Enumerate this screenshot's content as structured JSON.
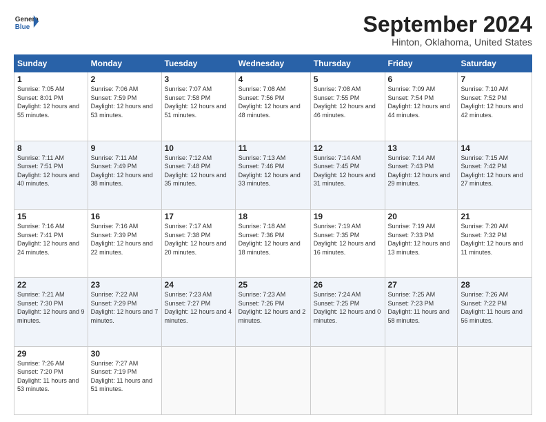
{
  "logo": {
    "line1": "General",
    "line2": "Blue"
  },
  "title": "September 2024",
  "subtitle": "Hinton, Oklahoma, United States",
  "weekdays": [
    "Sunday",
    "Monday",
    "Tuesday",
    "Wednesday",
    "Thursday",
    "Friday",
    "Saturday"
  ],
  "weeks": [
    [
      {
        "day": "1",
        "sunrise": "7:05 AM",
        "sunset": "8:01 PM",
        "daylight": "12 hours and 55 minutes."
      },
      {
        "day": "2",
        "sunrise": "7:06 AM",
        "sunset": "7:59 PM",
        "daylight": "12 hours and 53 minutes."
      },
      {
        "day": "3",
        "sunrise": "7:07 AM",
        "sunset": "7:58 PM",
        "daylight": "12 hours and 51 minutes."
      },
      {
        "day": "4",
        "sunrise": "7:08 AM",
        "sunset": "7:56 PM",
        "daylight": "12 hours and 48 minutes."
      },
      {
        "day": "5",
        "sunrise": "7:08 AM",
        "sunset": "7:55 PM",
        "daylight": "12 hours and 46 minutes."
      },
      {
        "day": "6",
        "sunrise": "7:09 AM",
        "sunset": "7:54 PM",
        "daylight": "12 hours and 44 minutes."
      },
      {
        "day": "7",
        "sunrise": "7:10 AM",
        "sunset": "7:52 PM",
        "daylight": "12 hours and 42 minutes."
      }
    ],
    [
      {
        "day": "8",
        "sunrise": "7:11 AM",
        "sunset": "7:51 PM",
        "daylight": "12 hours and 40 minutes."
      },
      {
        "day": "9",
        "sunrise": "7:11 AM",
        "sunset": "7:49 PM",
        "daylight": "12 hours and 38 minutes."
      },
      {
        "day": "10",
        "sunrise": "7:12 AM",
        "sunset": "7:48 PM",
        "daylight": "12 hours and 35 minutes."
      },
      {
        "day": "11",
        "sunrise": "7:13 AM",
        "sunset": "7:46 PM",
        "daylight": "12 hours and 33 minutes."
      },
      {
        "day": "12",
        "sunrise": "7:14 AM",
        "sunset": "7:45 PM",
        "daylight": "12 hours and 31 minutes."
      },
      {
        "day": "13",
        "sunrise": "7:14 AM",
        "sunset": "7:43 PM",
        "daylight": "12 hours and 29 minutes."
      },
      {
        "day": "14",
        "sunrise": "7:15 AM",
        "sunset": "7:42 PM",
        "daylight": "12 hours and 27 minutes."
      }
    ],
    [
      {
        "day": "15",
        "sunrise": "7:16 AM",
        "sunset": "7:41 PM",
        "daylight": "12 hours and 24 minutes."
      },
      {
        "day": "16",
        "sunrise": "7:16 AM",
        "sunset": "7:39 PM",
        "daylight": "12 hours and 22 minutes."
      },
      {
        "day": "17",
        "sunrise": "7:17 AM",
        "sunset": "7:38 PM",
        "daylight": "12 hours and 20 minutes."
      },
      {
        "day": "18",
        "sunrise": "7:18 AM",
        "sunset": "7:36 PM",
        "daylight": "12 hours and 18 minutes."
      },
      {
        "day": "19",
        "sunrise": "7:19 AM",
        "sunset": "7:35 PM",
        "daylight": "12 hours and 16 minutes."
      },
      {
        "day": "20",
        "sunrise": "7:19 AM",
        "sunset": "7:33 PM",
        "daylight": "12 hours and 13 minutes."
      },
      {
        "day": "21",
        "sunrise": "7:20 AM",
        "sunset": "7:32 PM",
        "daylight": "12 hours and 11 minutes."
      }
    ],
    [
      {
        "day": "22",
        "sunrise": "7:21 AM",
        "sunset": "7:30 PM",
        "daylight": "12 hours and 9 minutes."
      },
      {
        "day": "23",
        "sunrise": "7:22 AM",
        "sunset": "7:29 PM",
        "daylight": "12 hours and 7 minutes."
      },
      {
        "day": "24",
        "sunrise": "7:23 AM",
        "sunset": "7:27 PM",
        "daylight": "12 hours and 4 minutes."
      },
      {
        "day": "25",
        "sunrise": "7:23 AM",
        "sunset": "7:26 PM",
        "daylight": "12 hours and 2 minutes."
      },
      {
        "day": "26",
        "sunrise": "7:24 AM",
        "sunset": "7:25 PM",
        "daylight": "12 hours and 0 minutes."
      },
      {
        "day": "27",
        "sunrise": "7:25 AM",
        "sunset": "7:23 PM",
        "daylight": "11 hours and 58 minutes."
      },
      {
        "day": "28",
        "sunrise": "7:26 AM",
        "sunset": "7:22 PM",
        "daylight": "11 hours and 56 minutes."
      }
    ],
    [
      {
        "day": "29",
        "sunrise": "7:26 AM",
        "sunset": "7:20 PM",
        "daylight": "11 hours and 53 minutes."
      },
      {
        "day": "30",
        "sunrise": "7:27 AM",
        "sunset": "7:19 PM",
        "daylight": "11 hours and 51 minutes."
      },
      null,
      null,
      null,
      null,
      null
    ]
  ]
}
